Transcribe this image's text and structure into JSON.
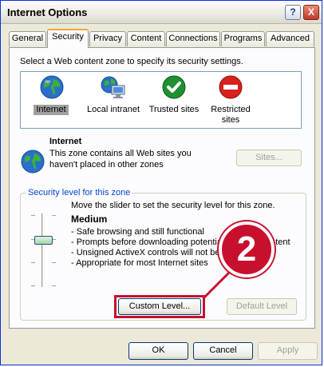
{
  "window": {
    "title": "Internet Options",
    "help_label": "?",
    "close_label": "X"
  },
  "tabs": [
    {
      "label": "General",
      "active": false
    },
    {
      "label": "Security",
      "active": true
    },
    {
      "label": "Privacy",
      "active": false
    },
    {
      "label": "Content",
      "active": false
    },
    {
      "label": "Connections",
      "active": false
    },
    {
      "label": "Programs",
      "active": false
    },
    {
      "label": "Advanced",
      "active": false
    }
  ],
  "security": {
    "instruction": "Select a Web content zone to specify its security settings.",
    "zones": [
      {
        "label_line1": "Internet",
        "label_line2": "",
        "icon": "globe-icon",
        "selected": true
      },
      {
        "label_line1": "Local intranet",
        "label_line2": "",
        "icon": "intranet-icon",
        "selected": false
      },
      {
        "label_line1": "Trusted sites",
        "label_line2": "",
        "icon": "check-icon",
        "selected": false
      },
      {
        "label_line1": "Restricted",
        "label_line2": "sites",
        "icon": "no-entry-icon",
        "selected": false
      }
    ],
    "zone_info": {
      "title": "Internet",
      "desc_line1": "This zone contains all Web sites you",
      "desc_line2": "haven't placed in other zones"
    },
    "sites_button": "Sites...",
    "level_group": {
      "title": "Security level for this zone",
      "instruction": "Move the slider to set the security level for this zone.",
      "level_name": "Medium",
      "level": "Medium",
      "bullets": [
        "- Safe browsing and still functional",
        "- Prompts before downloading potentially unsafe content",
        "- Unsigned ActiveX controls will not be downloaded",
        "- Appropriate for most Internet sites"
      ]
    },
    "custom_level_button": "Custom Level...",
    "default_level_button": "Default Level"
  },
  "footer": {
    "ok": "OK",
    "cancel": "Cancel",
    "apply": "Apply"
  },
  "annotation": {
    "step_number": "2",
    "color": "#c8102e"
  },
  "colors": {
    "title_text": "#000000",
    "group_title": "#0046d5",
    "active_tab_accent": "#f0a73c"
  }
}
